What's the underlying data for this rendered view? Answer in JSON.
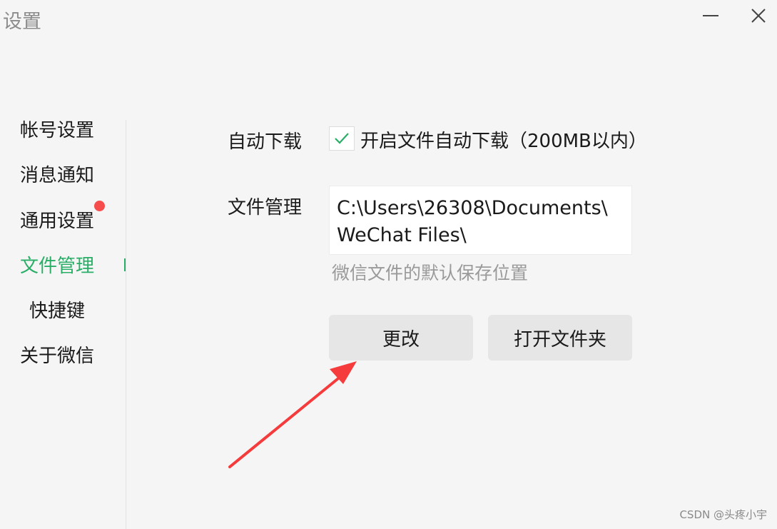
{
  "window": {
    "title": "设置",
    "minimize_icon": "minimize-icon",
    "close_icon": "close-icon"
  },
  "sidebar": {
    "items": [
      {
        "label": "帐号设置",
        "active": false
      },
      {
        "label": "消息通知",
        "active": false
      },
      {
        "label": "通用设置",
        "active": false,
        "badge": "red-dot"
      },
      {
        "label": "文件管理",
        "active": true
      },
      {
        "label": "快捷键",
        "active": false
      },
      {
        "label": "关于微信",
        "active": false
      }
    ]
  },
  "main": {
    "auto_download": {
      "label": "自动下载",
      "checkbox_checked": true,
      "checkbox_text": "开启文件自动下载（200MB以内）"
    },
    "file_management": {
      "label": "文件管理",
      "path": "C:\\Users\\26308\\Documents\\\nWeChat Files\\",
      "hint": "微信文件的默认保存位置"
    },
    "buttons": {
      "change": "更改",
      "open_folder": "打开文件夹"
    }
  },
  "annotation": {
    "arrow_color": "#f53b3b"
  },
  "colors": {
    "accent_green": "#2aae67",
    "badge_red": "#f74c4c",
    "background": "#f5f5f5",
    "button_bg": "#e6e6e6"
  },
  "watermark": "CSDN @头疼小宇"
}
